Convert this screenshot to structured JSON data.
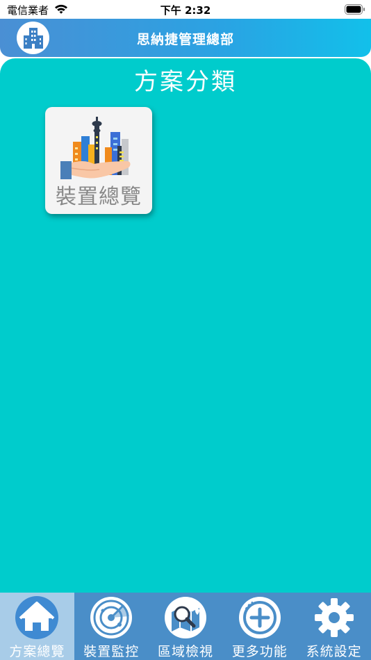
{
  "status_bar": {
    "carrier": "電信業者",
    "time": "下午 2:32"
  },
  "header": {
    "title": "思納捷管理總部",
    "logo_icon": "building-logo-icon"
  },
  "main": {
    "section_title": "方案分類",
    "tiles": [
      {
        "label": "裝置總覽",
        "icon": "city-in-hand-icon"
      }
    ]
  },
  "tab_bar": {
    "tabs": [
      {
        "label": "方案總覽",
        "icon": "home-icon",
        "active": true
      },
      {
        "label": "裝置監控",
        "icon": "radar-icon",
        "active": false
      },
      {
        "label": "區域檢視",
        "icon": "map-search-icon",
        "active": false
      },
      {
        "label": "更多功能",
        "icon": "plus-circle-icon",
        "active": false
      },
      {
        "label": "系統設定",
        "icon": "gear-icon",
        "active": false
      }
    ]
  },
  "colors": {
    "main_background": "#00cccc",
    "header_gradient_start": "#4a8fd4",
    "header_gradient_end": "#12c0ea",
    "tab_bar": "#4a8ec8",
    "tab_active": "#a8cce8"
  }
}
